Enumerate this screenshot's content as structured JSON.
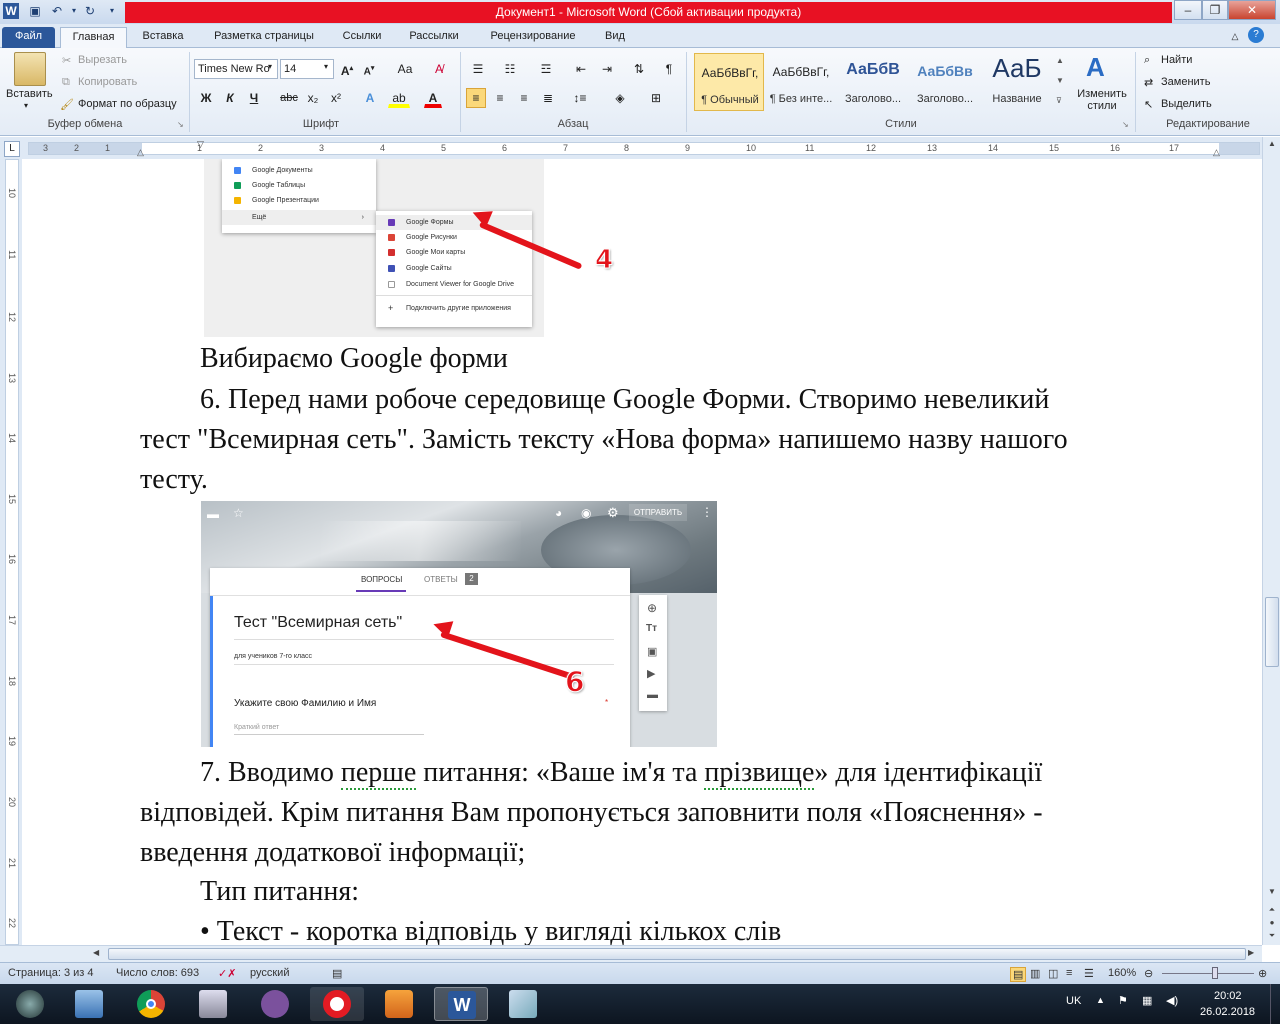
{
  "title": "Документ1 - Microsoft Word (Сбой активации продукта)",
  "tabs": [
    "Файл",
    "Главная",
    "Вставка",
    "Разметка страницы",
    "Ссылки",
    "Рассылки",
    "Рецензирование",
    "Вид"
  ],
  "clipboard": {
    "paste": "Вставить",
    "cut": "Вырезать",
    "copy": "Копировать",
    "format_painter": "Формат по образцу",
    "label": "Буфер обмена"
  },
  "font": {
    "name": "Times New Ro",
    "size": "14",
    "label": "Шрифт",
    "bold": "Ж",
    "italic": "К",
    "underline": "Ч",
    "strike": "abc",
    "sub": "x₂",
    "sup": "x²",
    "case": "Аа"
  },
  "paragraph": {
    "label": "Абзац"
  },
  "styles": {
    "label": "Стили",
    "items": [
      {
        "sample": "АаБбВвГг,",
        "name": "¶ Обычный"
      },
      {
        "sample": "АаБбВвГг,",
        "name": "¶ Без инте..."
      },
      {
        "sample": "АаБбВ",
        "name": "Заголово..."
      },
      {
        "sample": "АаБбВв",
        "name": "Заголово..."
      },
      {
        "sample": "АаБ",
        "name": "Название"
      }
    ],
    "change": "Изменить стили"
  },
  "editing": {
    "label": "Редактирование",
    "find": "Найти",
    "replace": "Заменить",
    "select": "Выделить"
  },
  "ruler_numbers": [
    "3",
    "2",
    "1",
    "1",
    "2",
    "3",
    "4",
    "5",
    "6",
    "7",
    "8",
    "9",
    "10",
    "11",
    "12",
    "13",
    "14",
    "15",
    "16",
    "17"
  ],
  "vruler_numbers": [
    "10",
    "11",
    "12",
    "13",
    "14",
    "15",
    "16",
    "17",
    "18",
    "19",
    "20",
    "21",
    "22"
  ],
  "shot1": {
    "menu1": [
      "Google Документы",
      "Google Таблицы",
      "Google Презентации",
      "Ещё"
    ],
    "menu2": [
      "Google Формы",
      "Google Рисунки",
      "Google Мои карты",
      "Google Сайты",
      "Document Viewer for Google Drive",
      "Подключить другие приложения"
    ],
    "callout": "4"
  },
  "doc": {
    "p1": "Вибираємо Google форми",
    "p2": "6. Перед нами робоче середовище Google Форми. Створимо невеликий",
    "p3": "тест \"Всемирная сеть\". Замість тексту «Нова форма» напишемо назву нашого",
    "p4": "тесту.",
    "p5a": "7. Вводимо ",
    "p5b": "перше",
    "p5c": " питання: «Ваше ім'я та ",
    "p5d": "прізвище",
    "p5e": "» для ідентифікації",
    "p6a": "відповідей.",
    "p6b": "  Крім питання Вам пропонується заповнити поля «Пояснення» -",
    "p7": "введення додаткової інформації;",
    "p8": "Тип питання:",
    "p9a": "• Текст - ",
    "p9b": "коротка",
    "p9c": " відповідь ",
    "p9d": " у вигляді кількох слів"
  },
  "shot2": {
    "send": "ОТПРАВИТЬ",
    "tab1": "ВОПРОСЫ",
    "tab2": "ОТВЕТЫ",
    "badge": "2",
    "form_title": "Тест \"Всемирная сеть\"",
    "desc": "для учеников 7-го класс",
    "question": "Укажите свою Фамилию и Имя",
    "answer_hint": "Краткий ответ",
    "callout": "6"
  },
  "status": {
    "page": "Страница: 3 из 4",
    "words": "Число слов: 693",
    "lang": "русский",
    "zoom": "160%"
  },
  "tray": {
    "lang": "UK",
    "time": "20:02",
    "date": "26.02.2018"
  }
}
